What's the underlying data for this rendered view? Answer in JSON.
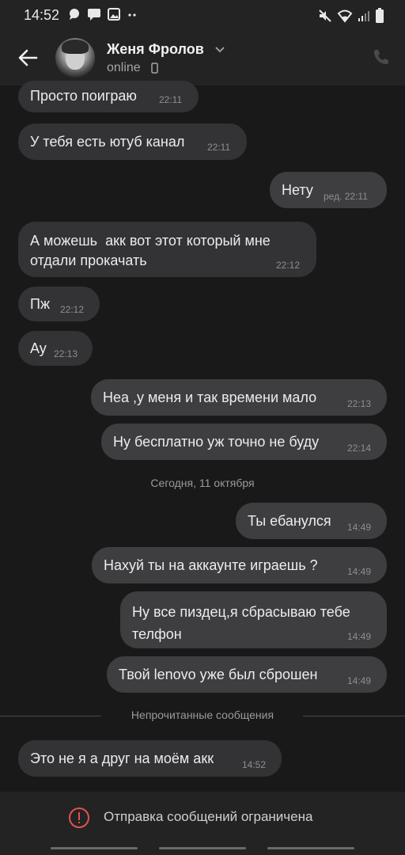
{
  "status_bar": {
    "time": "14:52"
  },
  "header": {
    "contact_name": "Женя Фролов",
    "status": "online"
  },
  "messages": [
    {
      "text": "Просто поиграю",
      "meta": "22:11"
    },
    {
      "text": "У тебя есть ютуб канал",
      "meta": "22:11"
    },
    {
      "text": "Нету",
      "meta": "ред. 22:11"
    },
    {
      "text": "А можешь  акк вот этот который мне\nотдали прокачать",
      "meta": "22:12"
    },
    {
      "text": "Пж",
      "meta": "22:12"
    },
    {
      "text": "Ау",
      "meta": "22:13"
    },
    {
      "text": "Неа ,у меня и так времени мало",
      "meta": "22:13"
    },
    {
      "text": "Ну бесплатно уж точно не буду",
      "meta": "22:14"
    },
    {
      "text": "Ты ебанулся",
      "meta": "14:49"
    },
    {
      "text": "Нахуй ты на аккаунте играешь ?",
      "meta": "14:49"
    },
    {
      "text": "Ну все пиздец,я сбрасываю тебе\nтелфон",
      "meta": "14:49"
    },
    {
      "text": "Твой lenovo уже был сброшен",
      "meta": "14:49"
    },
    {
      "text": "Это не я а друг на моём акк",
      "meta": "14:52"
    }
  ],
  "date_separator": "Сегодня, 11 октября",
  "unread_separator": "Непрочитанные сообщения",
  "footer": {
    "restriction_text": "Отправка сообщений ограничена"
  },
  "colors": {
    "background": "#19191a",
    "bar": "#232323",
    "incoming_bubble": "#333335",
    "outgoing_bubble": "#3e3e41",
    "warning": "#e0534e"
  }
}
